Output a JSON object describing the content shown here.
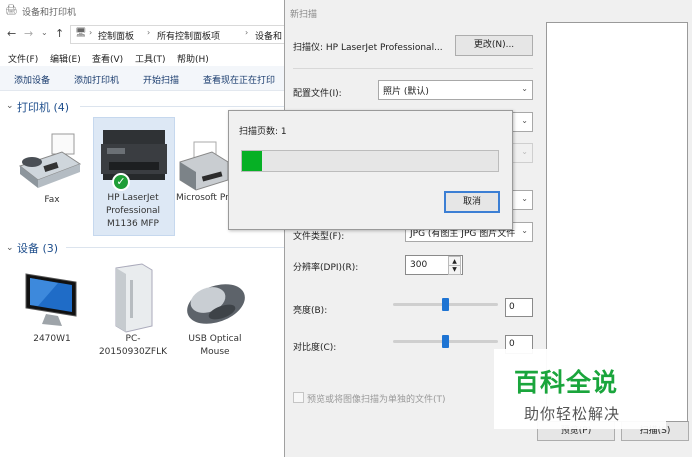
{
  "explorer": {
    "title": "设备和打印机",
    "breadcrumb": [
      "控制面板",
      "所有控制面板项",
      "设备和"
    ],
    "menu": [
      "文件(F)",
      "编辑(E)",
      "查看(V)",
      "工具(T)",
      "帮助(H)"
    ],
    "commands": [
      "添加设备",
      "添加打印机",
      "开始扫描",
      "查看现在正在打印"
    ],
    "printers_header": "打印机 (4)",
    "printers": [
      {
        "label": "Fax",
        "icon": "fax-icon"
      },
      {
        "label": "HP LaserJet Professional M1136 MFP",
        "icon": "mfp-printer-icon",
        "selected": true
      },
      {
        "label": "Microsoft Print to PDF",
        "icon": "printer-icon"
      }
    ],
    "devices_header": "设备 (3)",
    "devices": [
      {
        "label": "2470W1",
        "icon": "monitor-icon"
      },
      {
        "label": "PC-20150930ZFLK",
        "icon": "computer-tower-icon"
      },
      {
        "label": "USB Optical Mouse",
        "icon": "mouse-icon"
      }
    ]
  },
  "scan_dialog": {
    "title": "新扫描",
    "scanner_label": "扫描仪: HP LaserJet Professional...",
    "change_button": "更改(N)...",
    "profile_label": "配置文件(I):",
    "profile_value": "照片 (默认)",
    "file_type_label": "文件类型(F):",
    "file_type_value": "JPG (有图主 JPG 图片文件",
    "resolution_label": "分辨率(DPI)(R):",
    "resolution_value": "300",
    "brightness_label": "亮度(B):",
    "brightness_value": "0",
    "brightness_level": 0.5,
    "contrast_label": "对比度(C):",
    "contrast_value": "0",
    "contrast_level": 0.5,
    "separate_files_label": "预览或将图像扫描为单独的文件(T)",
    "preview_button": "预览(P)",
    "scan_button": "扫描(S)"
  },
  "progress": {
    "pages_label": "扫描页数: 1",
    "fraction": 0.08,
    "cancel_button": "取消",
    "fill_color": "#06b025"
  },
  "watermark": {
    "title": "百科全说",
    "subtitle": "助你轻松解决"
  }
}
